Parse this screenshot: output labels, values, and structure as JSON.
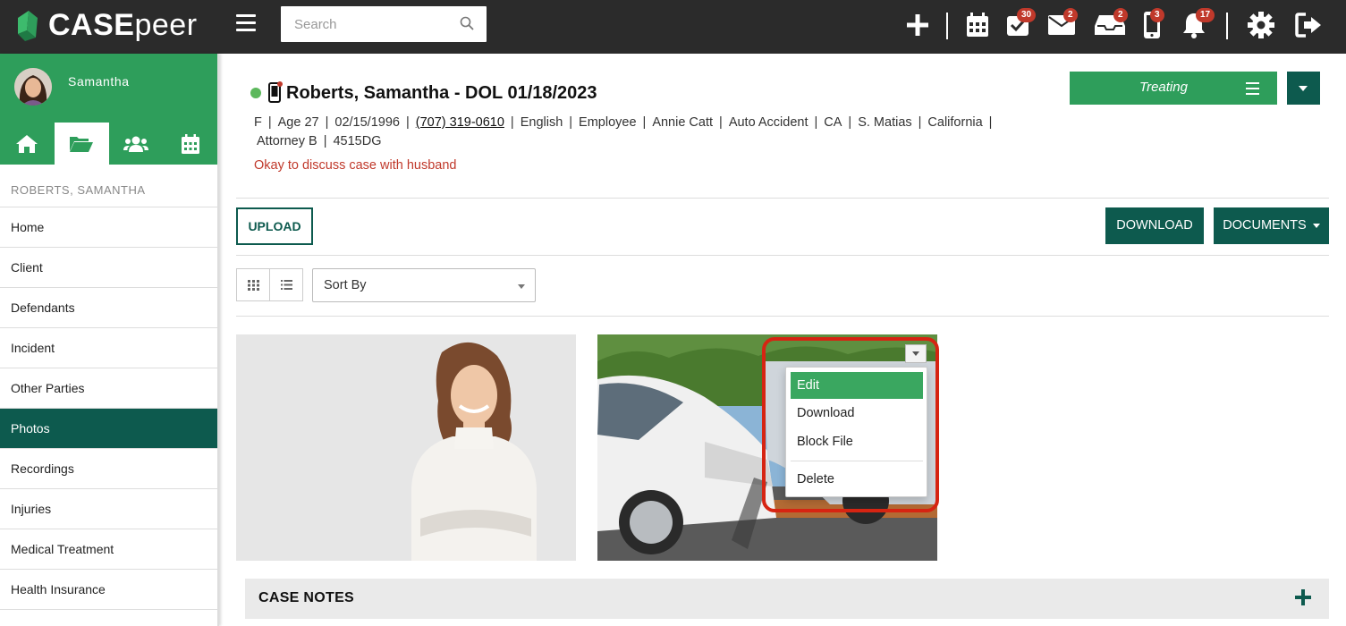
{
  "app": {
    "logo_main": "CASE",
    "logo_thin": "peer",
    "colors": {
      "topbar": "#2b2b2b",
      "brand_green": "#2e9e5b",
      "dark_teal": "#0d5a4e",
      "badge_red": "#c0392b",
      "alert_red": "#c0392b",
      "highlight_red": "#d62412"
    }
  },
  "topbar": {
    "search_placeholder": "Search",
    "icons": [
      {
        "name": "plus-icon"
      },
      {
        "name": "calendar-icon"
      },
      {
        "name": "tasks-check-icon",
        "badge": "30"
      },
      {
        "name": "mail-icon",
        "badge": "2"
      },
      {
        "name": "inbox-icon",
        "badge": "2"
      },
      {
        "name": "mobile-phone-icon",
        "badge": "3"
      },
      {
        "name": "bell-icon",
        "badge": "17"
      },
      {
        "name": "gear-icon"
      },
      {
        "name": "logout-icon"
      }
    ]
  },
  "sidebar": {
    "user_name": "Samantha",
    "tabs": [
      "home-icon",
      "folder-open-icon",
      "users-icon",
      "calendar-icon"
    ],
    "active_tab": 1,
    "case_name": "ROBERTS, SAMANTHA",
    "items": [
      {
        "label": "Home"
      },
      {
        "label": "Client"
      },
      {
        "label": "Defendants"
      },
      {
        "label": "Incident"
      },
      {
        "label": "Other Parties"
      },
      {
        "label": "Photos",
        "active": true
      },
      {
        "label": "Recordings"
      },
      {
        "label": "Injuries"
      },
      {
        "label": "Medical Treatment"
      },
      {
        "label": "Health Insurance"
      }
    ]
  },
  "case": {
    "title": "Roberts, Samantha - DOL 01/18/2023",
    "status_color": "#5cb85c",
    "info": {
      "gender": "F",
      "age": "Age 27",
      "dob": "02/15/1996",
      "phone": "(707) 319-0610",
      "language": "English",
      "occupation": "Employee",
      "staff": "Annie Catt",
      "case_type": "Auto Accident",
      "state": "CA",
      "person": "S. Matias",
      "location": "California",
      "attorney": "Attorney B",
      "code": "4515DG"
    },
    "alert": "Okay to discuss case with husband",
    "status_label": "Treating"
  },
  "toolbar": {
    "upload": "UPLOAD",
    "download": "DOWNLOAD",
    "documents": "DOCUMENTS",
    "sort_by": "Sort By"
  },
  "photo_menu": {
    "items": [
      "Edit",
      "Download",
      "Block File",
      "Delete"
    ],
    "active": "Edit"
  },
  "case_notes": {
    "title": "CASE NOTES"
  }
}
